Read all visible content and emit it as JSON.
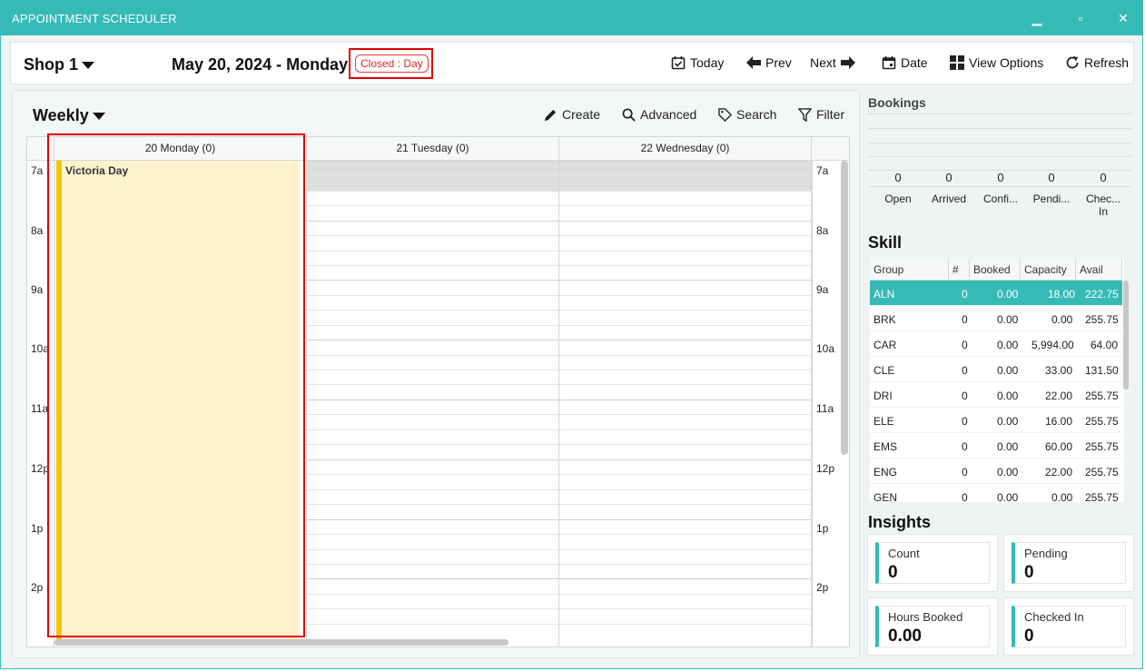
{
  "window": {
    "title": "APPOINTMENT SCHEDULER"
  },
  "toolbar": {
    "shop": "Shop 1",
    "date": "May 20, 2024 - Monday",
    "closed_badge": "Closed : Day",
    "buttons": {
      "today": "Today",
      "prev": "Prev",
      "next": "Next",
      "date": "Date",
      "view_options": "View Options",
      "refresh": "Refresh"
    }
  },
  "calendar": {
    "view": "Weekly",
    "actions": {
      "create": "Create",
      "advanced": "Advanced",
      "search": "Search",
      "filter": "Filter"
    },
    "days": [
      "20 Monday (0)",
      "21 Tuesday (0)",
      "22 Wednesday (0)"
    ],
    "hours": [
      "7a",
      "8a",
      "9a",
      "10a",
      "11a",
      "12p",
      "1p",
      "2p"
    ],
    "holiday": "Victoria Day"
  },
  "bookings": {
    "title": "Bookings",
    "stats": [
      {
        "count": "0",
        "label": "Open"
      },
      {
        "count": "0",
        "label": "Arrived"
      },
      {
        "count": "0",
        "label": "Confi..."
      },
      {
        "count": "0",
        "label": "Pendi..."
      },
      {
        "count": "0",
        "label": "Chec...\nIn"
      }
    ]
  },
  "skill": {
    "title": "Skill",
    "headers": [
      "Group",
      "#",
      "Booked",
      "Capacity",
      "Avail"
    ],
    "rows": [
      [
        "ALN",
        "0",
        "0.00",
        "18.00",
        "222.75"
      ],
      [
        "BRK",
        "0",
        "0.00",
        "0.00",
        "255.75"
      ],
      [
        "CAR",
        "0",
        "0.00",
        "5,994.00",
        "64.00"
      ],
      [
        "CLE",
        "0",
        "0.00",
        "33.00",
        "131.50"
      ],
      [
        "DRI",
        "0",
        "0.00",
        "22.00",
        "255.75"
      ],
      [
        "ELE",
        "0",
        "0.00",
        "16.00",
        "255.75"
      ],
      [
        "EMS",
        "0",
        "0.00",
        "60.00",
        "255.75"
      ],
      [
        "ENG",
        "0",
        "0.00",
        "22.00",
        "255.75"
      ],
      [
        "GEN",
        "0",
        "0.00",
        "0.00",
        "255.75"
      ]
    ],
    "selected_row": 0
  },
  "insights": {
    "title": "Insights",
    "cards": [
      {
        "label": "Count",
        "value": "0"
      },
      {
        "label": "Pending",
        "value": "0"
      },
      {
        "label": "Hours Booked",
        "value": "0.00"
      },
      {
        "label": "Checked In",
        "value": "0"
      }
    ]
  },
  "colors": {
    "accent": "#36bab6",
    "holiday": "#fff3cf",
    "holiday_bar": "#f5c400",
    "highlight": "#e00000"
  }
}
